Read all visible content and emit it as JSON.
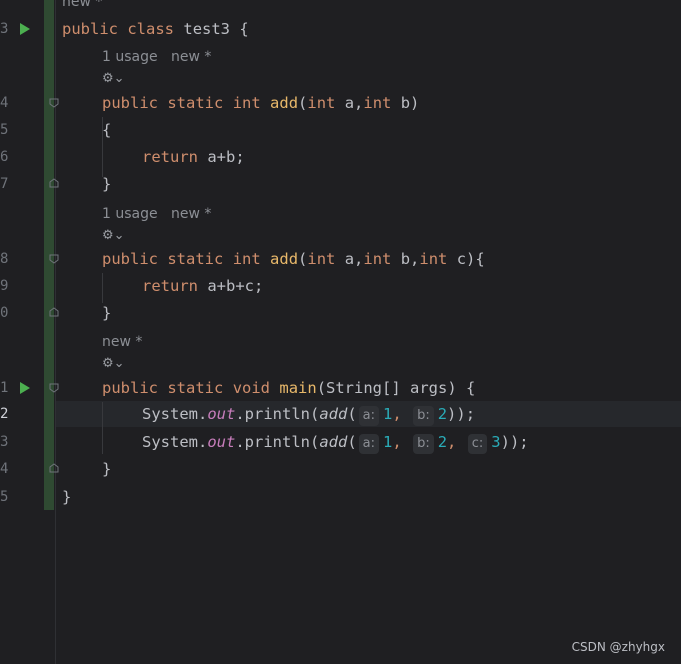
{
  "editor": {
    "top_lens": "new *",
    "line_numbers": [
      "3",
      "",
      "",
      "4",
      "5",
      "6",
      "7",
      "",
      "",
      "8",
      "9",
      "0",
      "",
      "",
      "1",
      "2",
      "3",
      "4",
      "5"
    ],
    "class_decl": {
      "kw1": "public",
      "kw2": "class",
      "name": "test3",
      "brace": " {"
    },
    "lens1": {
      "usage": "1 usage",
      "author": "new *"
    },
    "method1": {
      "kw1": "public",
      "kw2": "static",
      "kw3": "int",
      "name": "add",
      "params_open": "(",
      "p1type": "int",
      "p1name": " a,",
      "p2type": "int",
      "p2name": " b)",
      "open_brace": "{",
      "ret": "return",
      "body": " a+b;",
      "close_brace": "}"
    },
    "lens2": {
      "usage": "1 usage",
      "author": "new *"
    },
    "method2": {
      "kw1": "public",
      "kw2": "static",
      "kw3": "int",
      "name": "add",
      "sig": "(",
      "p1": "int",
      " p1n": " a,",
      "p2": "int",
      "p2n": " b,",
      "p3": "int",
      "p3n": " c){",
      "ret": "return",
      "body": " a+b+c;",
      "close_brace": "}"
    },
    "lens3": {
      "author": "new *"
    },
    "main": {
      "kw1": "public",
      "kw2": "static",
      "kw3": "void",
      "name": "main",
      "sig": "(String[] args) {",
      "close_brace": "}"
    },
    "call1": {
      "obj": "System.",
      "field": "out",
      "rest": ".println(",
      "fn": "add",
      "open": "(",
      "hint_a": "a:",
      "val_a": "1",
      "comma1": ",",
      "hint_b": "b:",
      "val_b": "2",
      "close": "));"
    },
    "call2": {
      "obj": "System.",
      "field": "out",
      "rest": ".println(",
      "fn": "add",
      "open": "(",
      "hint_a": "a:",
      "val_a": "1",
      "comma1": ",",
      "hint_b": "b:",
      "val_b": "2",
      "comma2": ",",
      "hint_c": "c:",
      "val_c": "3",
      "close": "));"
    },
    "class_close": "}"
  },
  "watermark": "CSDN @zhyhgx",
  "colors": {
    "keyword": "#cf8e6d",
    "method": "#e8b86a",
    "number": "#2aacb8",
    "field": "#c77dbb",
    "text": "#bcbec4",
    "run": "#4caf50"
  }
}
